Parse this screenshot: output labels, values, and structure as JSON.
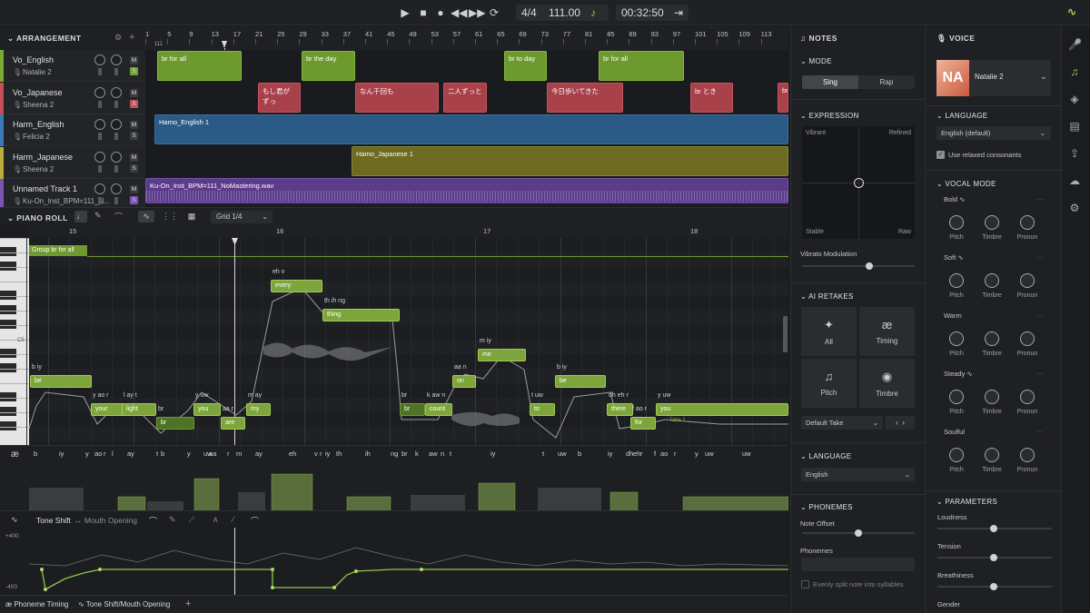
{
  "transport": {
    "time_sig": "4/4",
    "tempo": "111.00",
    "time": "00:32:50"
  },
  "arrangement": {
    "title": "ARRANGEMENT",
    "ruler": [
      "1",
      "5",
      "9",
      "13",
      "17",
      "21",
      "25",
      "29",
      "33",
      "37",
      "41",
      "45",
      "49",
      "53",
      "57",
      "61",
      "65",
      "69",
      "73",
      "77",
      "81",
      "85",
      "89",
      "93",
      "97",
      "101",
      "105",
      "109",
      "113"
    ],
    "marker": "111",
    "tracks": [
      {
        "name": "Vo_English",
        "voice": "Natalie 2",
        "color": "#78ab35"
      },
      {
        "name": "Vo_Japanese",
        "voice": "Sheena 2",
        "color": "#c4505a"
      },
      {
        "name": "Harm_English",
        "voice": "Felicia 2",
        "color": "#3c78b4"
      },
      {
        "name": "Harm_Japanese",
        "voice": "Sheena 2",
        "color": "#b9ac3a"
      },
      {
        "name": "Unnamed Track 1",
        "voice": "Ku-On_Inst_BPM=111_N...",
        "color": "#7a55b0"
      }
    ],
    "clips_en": [
      "br for all",
      "br the day",
      "br to day",
      "br for all"
    ],
    "clips_jp": [
      "もし君がずっ",
      "なん千回も",
      "二人ずっと",
      "今日歩いてきた",
      "br とき",
      "br"
    ],
    "clip_harm_en": "Hamo_English 1",
    "clip_harm_jp": "Hamo_Japanese 1",
    "clip_inst": "Ku-On_Inst_BPM=111_NoMastering.wav"
  },
  "piano_roll": {
    "title": "PIANO ROLL",
    "grid": "Grid 1/4",
    "bars": [
      "15",
      "16",
      "17",
      "18"
    ],
    "group_label": "Group br for all",
    "c_label": "C5",
    "take_label": "Take 1",
    "phoneme_sym": "æ",
    "phonemes": [
      "b",
      "iy",
      "y",
      "ao",
      "r",
      "l",
      "ay",
      "t",
      "b",
      "y",
      "uw",
      "aa",
      "r",
      "m",
      "ay",
      "eh",
      "v",
      "r",
      "iy",
      "th",
      "ih",
      "ng",
      "br",
      "k",
      "aw",
      "n",
      "t",
      "iy",
      "t",
      "uw",
      "b",
      "iy",
      "dh",
      "eh",
      "r",
      "f",
      "ao",
      "r",
      "y",
      "uw",
      "uw"
    ],
    "notes": [
      {
        "lyric": "be",
        "ph": "b iy"
      },
      {
        "lyric": "your",
        "ph": "y ao r"
      },
      {
        "lyric": "light",
        "ph": "l ay t"
      },
      {
        "lyric": "br",
        "ph": "br"
      },
      {
        "lyric": "you",
        "ph": "y uw"
      },
      {
        "lyric": "are",
        "ph": "aa r"
      },
      {
        "lyric": "my",
        "ph": "m ay"
      },
      {
        "lyric": "every",
        "ph": "eh v"
      },
      {
        "lyric": "thing",
        "ph": "th ih ng"
      },
      {
        "lyric": "br",
        "ph": "br"
      },
      {
        "lyric": "count",
        "ph": "k aw n"
      },
      {
        "lyric": "on",
        "ph": "aa n"
      },
      {
        "lyric": "me",
        "ph": "m iy"
      },
      {
        "lyric": "to",
        "ph": "t uw"
      },
      {
        "lyric": "be",
        "ph": "b iy"
      },
      {
        "lyric": "there",
        "ph": "dh eh r"
      },
      {
        "lyric": "for",
        "ph": "f ao r"
      },
      {
        "lyric": "you",
        "ph": "y uw"
      }
    ],
    "param_tabs": {
      "active": "Tone Shift",
      "inactive": "Mouth Opening"
    },
    "param_range": {
      "top": "+400",
      "bottom": "-400"
    },
    "bottom_tabs": [
      "Phoneme Timing",
      "Tone Shift/Mouth Opening"
    ]
  },
  "notes_panel": {
    "title": "NOTES",
    "mode": {
      "label": "MODE",
      "options": [
        "Sing",
        "Rap"
      ],
      "selected": "Sing"
    },
    "expression": {
      "label": "EXPRESSION",
      "tl": "Vibrant",
      "tr": "Refined",
      "bl": "Stable",
      "br": "Raw"
    },
    "vibrato": "Vibrato Modulation",
    "retakes": {
      "label": "AI RETAKES",
      "items": [
        "All",
        "Timing",
        "Pitch",
        "Timbre"
      ],
      "select": "Default Take"
    },
    "language": {
      "label": "LANGUAGE",
      "value": "English"
    },
    "phonemes": {
      "label": "PHONEMES",
      "offset": "Note Offset",
      "field": "Phonemes",
      "checkbox": "Evenly split note into syllables"
    }
  },
  "voice_panel": {
    "title": "VOICE",
    "name": "Natalie 2",
    "logo": "NA",
    "language_label": "LANGUAGE",
    "language": "English (default)",
    "relaxed": "Use relaxed consonants",
    "vocal_mode_label": "VOCAL MODE",
    "modes": [
      "Bold",
      "Soft",
      "Warm",
      "Steady",
      "Soulful"
    ],
    "knob_labels": [
      "Pitch",
      "Timbre",
      "Pronun"
    ],
    "parameters_label": "PARAMETERS",
    "parameters": [
      "Loudness",
      "Tension",
      "Breathiness",
      "Gender"
    ]
  }
}
